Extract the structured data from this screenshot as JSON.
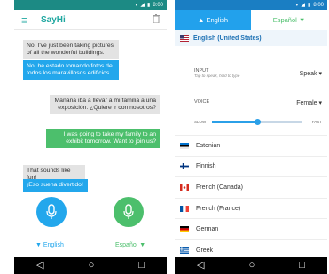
{
  "status": {
    "time": "8:00"
  },
  "left": {
    "app_title": "SayHi",
    "messages": [
      {
        "text": "No, I've just been taking pictures of all the wonderful buildings.",
        "kind": "gray"
      },
      {
        "text": "No, he estado tomando fotos de todos los maravillosos edificios.",
        "kind": "blue"
      },
      {
        "text": "Mañana iba a llevar a mi familia a una exposición. ¿Quiere ir con nosotros?",
        "kind": "gray"
      },
      {
        "text": "I was going to take my family to an exhibit tomorrow. Want to join us?",
        "kind": "green"
      },
      {
        "text": "That sounds like fun!",
        "kind": "gray"
      },
      {
        "text": "¡Eso suena divertido!",
        "kind": "blue"
      }
    ],
    "lang_left": "▼ English",
    "lang_right": "Español ▼",
    "colors": {
      "teal": "#1fa7a0",
      "blue": "#23a7ec",
      "green": "#4cbf6c"
    }
  },
  "right": {
    "tab_left": "▲ English",
    "tab_right": "Español ▼",
    "selected_language": "English (United States)",
    "input_label": "INPUT",
    "input_hint": "Tap to speak, hold to type",
    "input_value": "Speak",
    "voice_label": "VOICE",
    "voice_value": "Female",
    "slow_label": "SLOW",
    "fast_label": "FAST",
    "speed_fraction": 0.5,
    "languages": [
      "Estonian",
      "Finnish",
      "French (Canada)",
      "French (France)",
      "German",
      "Greek"
    ]
  }
}
